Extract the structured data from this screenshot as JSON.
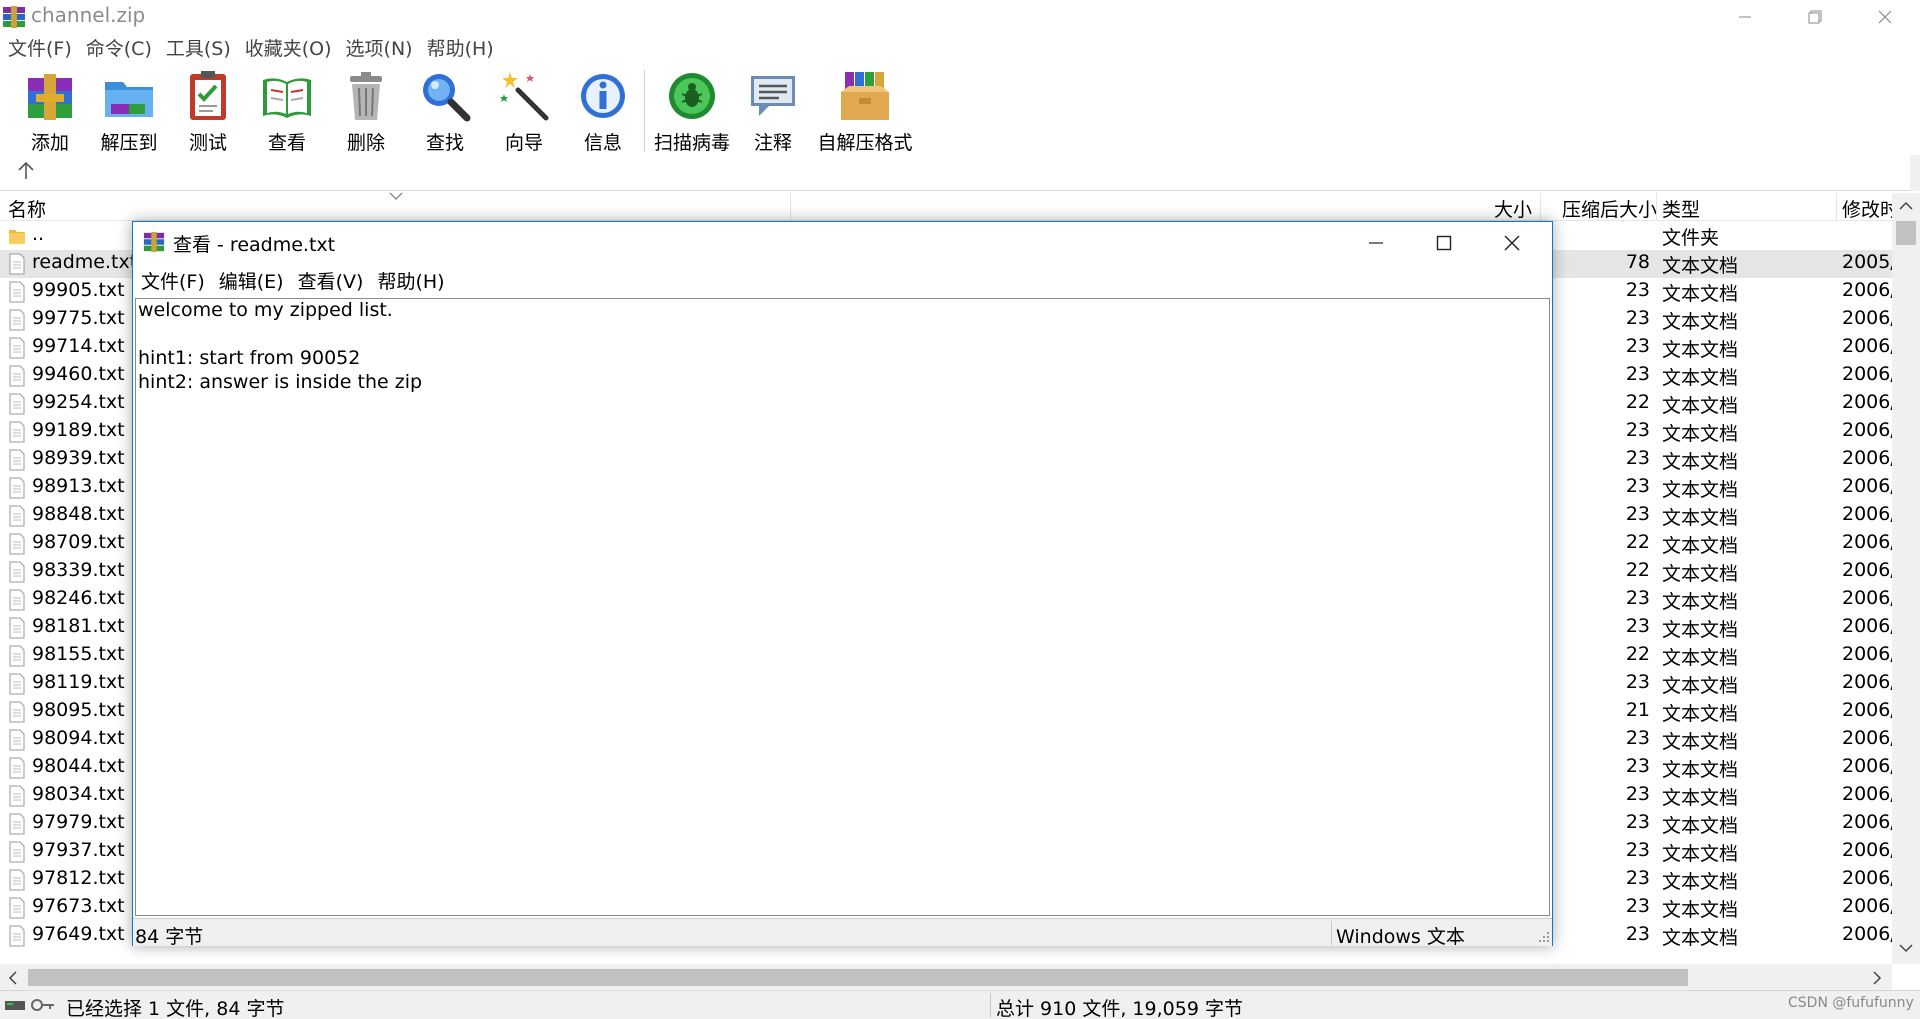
{
  "window": {
    "title": "channel.zip"
  },
  "menu": [
    "文件(F)",
    "命令(C)",
    "工具(S)",
    "收藏夹(O)",
    "选项(N)",
    "帮助(H)"
  ],
  "toolbar": [
    {
      "label": "添加",
      "icon": "add-archive-icon"
    },
    {
      "label": "解压到",
      "icon": "extract-to-icon"
    },
    {
      "label": "测试",
      "icon": "test-icon"
    },
    {
      "label": "查看",
      "icon": "view-icon"
    },
    {
      "label": "删除",
      "icon": "delete-icon"
    },
    {
      "label": "查找",
      "icon": "find-icon"
    },
    {
      "label": "向导",
      "icon": "wizard-icon"
    },
    {
      "label": "信息",
      "icon": "info-icon"
    },
    {
      "label": "扫描病毒",
      "icon": "scan-virus-icon"
    },
    {
      "label": "注释",
      "icon": "comment-icon"
    },
    {
      "label": "自解压格式",
      "icon": "sfx-icon"
    }
  ],
  "columns": {
    "name": "名称",
    "size": "大小",
    "packed": "压缩后大小",
    "type": "类型",
    "modified": "修改时"
  },
  "files": [
    {
      "name": "..",
      "size": "",
      "type": "文件夹",
      "modified": "",
      "kind": "folder"
    },
    {
      "name": "readme.txt",
      "size": "78",
      "type": "文本文档",
      "modified": "2005/",
      "kind": "text",
      "selected": true
    },
    {
      "name": "99905.txt",
      "size": "23",
      "type": "文本文档",
      "modified": "2006/",
      "kind": "text"
    },
    {
      "name": "99775.txt",
      "size": "23",
      "type": "文本文档",
      "modified": "2006/",
      "kind": "text"
    },
    {
      "name": "99714.txt",
      "size": "23",
      "type": "文本文档",
      "modified": "2006/",
      "kind": "text"
    },
    {
      "name": "99460.txt",
      "size": "23",
      "type": "文本文档",
      "modified": "2006/",
      "kind": "text"
    },
    {
      "name": "99254.txt",
      "size": "22",
      "type": "文本文档",
      "modified": "2006/",
      "kind": "text"
    },
    {
      "name": "99189.txt",
      "size": "23",
      "type": "文本文档",
      "modified": "2006/",
      "kind": "text"
    },
    {
      "name": "98939.txt",
      "size": "23",
      "type": "文本文档",
      "modified": "2006/",
      "kind": "text"
    },
    {
      "name": "98913.txt",
      "size": "23",
      "type": "文本文档",
      "modified": "2006/",
      "kind": "text"
    },
    {
      "name": "98848.txt",
      "size": "23",
      "type": "文本文档",
      "modified": "2006/",
      "kind": "text"
    },
    {
      "name": "98709.txt",
      "size": "22",
      "type": "文本文档",
      "modified": "2006/",
      "kind": "text"
    },
    {
      "name": "98339.txt",
      "size": "22",
      "type": "文本文档",
      "modified": "2006/",
      "kind": "text"
    },
    {
      "name": "98246.txt",
      "size": "23",
      "type": "文本文档",
      "modified": "2006/",
      "kind": "text"
    },
    {
      "name": "98181.txt",
      "size": "23",
      "type": "文本文档",
      "modified": "2006/",
      "kind": "text"
    },
    {
      "name": "98155.txt",
      "size": "22",
      "type": "文本文档",
      "modified": "2006/",
      "kind": "text"
    },
    {
      "name": "98119.txt",
      "size": "23",
      "type": "文本文档",
      "modified": "2006/",
      "kind": "text"
    },
    {
      "name": "98095.txt",
      "size": "21",
      "type": "文本文档",
      "modified": "2006/",
      "kind": "text"
    },
    {
      "name": "98094.txt",
      "size": "23",
      "type": "文本文档",
      "modified": "2006/",
      "kind": "text"
    },
    {
      "name": "98044.txt",
      "size": "23",
      "type": "文本文档",
      "modified": "2006/",
      "kind": "text"
    },
    {
      "name": "98034.txt",
      "size": "23",
      "type": "文本文档",
      "modified": "2006/",
      "kind": "text"
    },
    {
      "name": "97979.txt",
      "size": "23",
      "type": "文本文档",
      "modified": "2006/",
      "kind": "text"
    },
    {
      "name": "97937.txt",
      "size": "23",
      "type": "文本文档",
      "modified": "2006/",
      "kind": "text"
    },
    {
      "name": "97812.txt",
      "size": "23",
      "type": "文本文档",
      "modified": "2006/",
      "kind": "text"
    },
    {
      "name": "97673.txt",
      "size": "23",
      "type": "文本文档",
      "modified": "2006/",
      "kind": "text"
    },
    {
      "name": "97649.txt",
      "size": "23",
      "type": "文本文档",
      "modified": "2006/",
      "kind": "text"
    }
  ],
  "status": {
    "left": "已经选择 1 文件, 84 字节",
    "right": "总计 910 文件, 19,059 字节",
    "watermark": "CSDN @fufufunny"
  },
  "viewer": {
    "title": "查看 - readme.txt",
    "menu": [
      "文件(F)",
      "编辑(E)",
      "查看(V)",
      "帮助(H)"
    ],
    "lines": [
      "welcome to my zipped list.",
      "",
      "hint1: start from 90052",
      "hint2: answer is inside the zip"
    ],
    "status_left": "84 字节",
    "status_right": "Windows 文本"
  }
}
